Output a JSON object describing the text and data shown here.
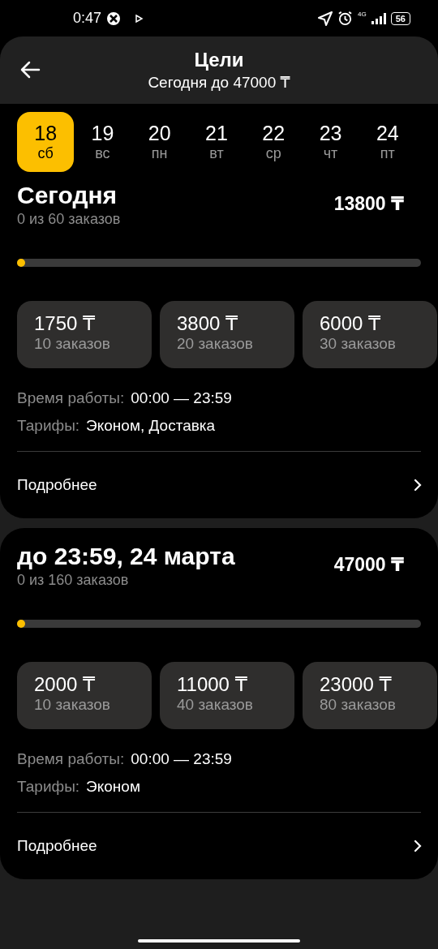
{
  "status_bar": {
    "time": "0:47",
    "network": "4G",
    "battery": "56"
  },
  "header": {
    "title": "Цели",
    "subtitle": "Сегодня до 47000 ₸"
  },
  "days": [
    {
      "date": "18",
      "weekday": "сб",
      "selected": true
    },
    {
      "date": "19",
      "weekday": "вс",
      "selected": false
    },
    {
      "date": "20",
      "weekday": "пн",
      "selected": false
    },
    {
      "date": "21",
      "weekday": "вт",
      "selected": false
    },
    {
      "date": "22",
      "weekday": "ср",
      "selected": false
    },
    {
      "date": "23",
      "weekday": "чт",
      "selected": false
    },
    {
      "date": "24",
      "weekday": "пт",
      "selected": false
    }
  ],
  "goals": [
    {
      "title": "Сегодня",
      "progress": "0 из 60 заказов",
      "amount": "13800 ₸",
      "level": 0.01,
      "tiers": [
        {
          "amount": "1750 ₸",
          "orders": "10 заказов"
        },
        {
          "amount": "3800 ₸",
          "orders": "20 заказов"
        },
        {
          "amount": "6000 ₸",
          "orders": "30 заказов"
        }
      ],
      "hours_label": "Время работы:",
      "hours": "00:00 — 23:59",
      "tariffs_label": "Тарифы:",
      "tariffs": "Эконом, Доставка",
      "more": "Подробнее"
    },
    {
      "title": "до 23:59, 24 марта",
      "progress": "0 из 160 заказов",
      "amount": "47000 ₸",
      "level": 0.01,
      "tiers": [
        {
          "amount": "2000 ₸",
          "orders": "10 заказов"
        },
        {
          "amount": "11000 ₸",
          "orders": "40 заказов"
        },
        {
          "amount": "23000 ₸",
          "orders": "80 заказов"
        }
      ],
      "hours_label": "Время работы:",
      "hours": "00:00 — 23:59",
      "tariffs_label": "Тарифы:",
      "tariffs": "Эконом",
      "more": "Подробнее"
    }
  ]
}
